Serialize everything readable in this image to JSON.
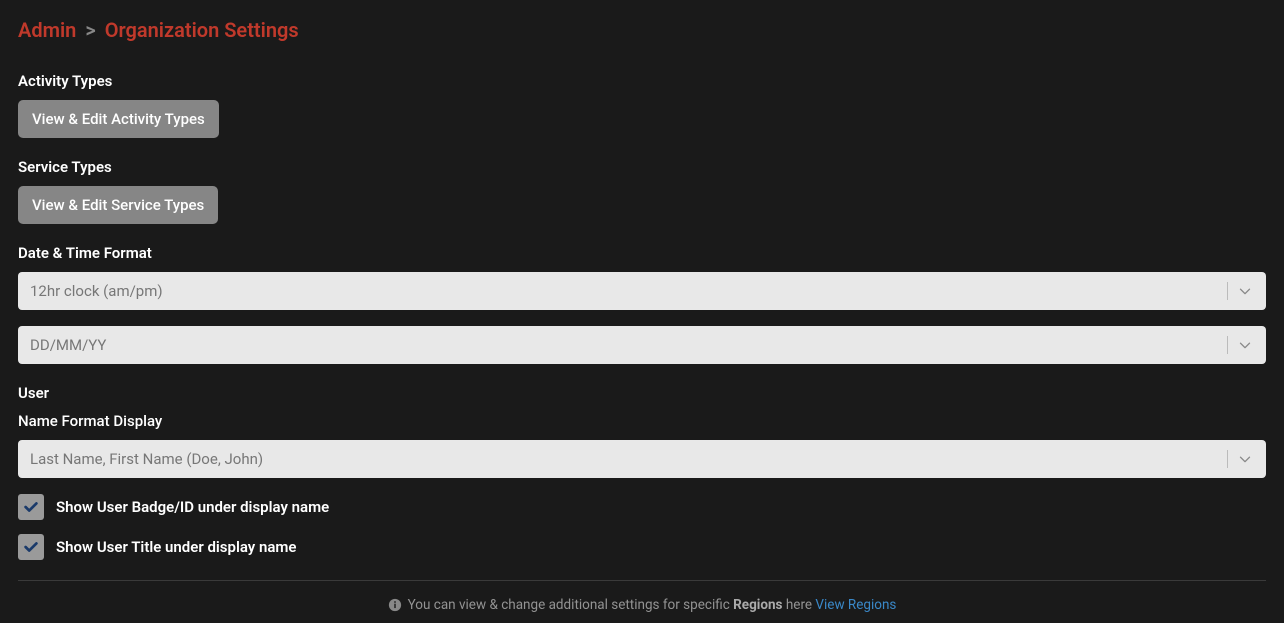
{
  "breadcrumb": {
    "parent": "Admin",
    "separator": ">",
    "current": "Organization Settings"
  },
  "sections": {
    "activity_types": {
      "label": "Activity Types",
      "button": "View & Edit Activity Types"
    },
    "service_types": {
      "label": "Service Types",
      "button": "View & Edit Service Types"
    },
    "datetime": {
      "label": "Date & Time Format",
      "time_select_value": "12hr clock (am/pm)",
      "date_select_value": "DD/MM/YY"
    },
    "user": {
      "label": "User",
      "name_format_label": "Name Format Display",
      "name_format_value": "Last Name, First Name (Doe, John)",
      "show_badge": {
        "label": "Show User Badge/ID under display name",
        "checked": true
      },
      "show_title": {
        "label": "Show User Title under display name",
        "checked": true
      }
    }
  },
  "footer": {
    "text_prefix": "You can view & change additional settings for specific ",
    "text_strong": "Regions",
    "text_suffix": " here ",
    "link_text": "View Regions"
  },
  "colors": {
    "accent": "#c0392b",
    "link": "#3a88c8",
    "background": "#1a1a1a"
  }
}
